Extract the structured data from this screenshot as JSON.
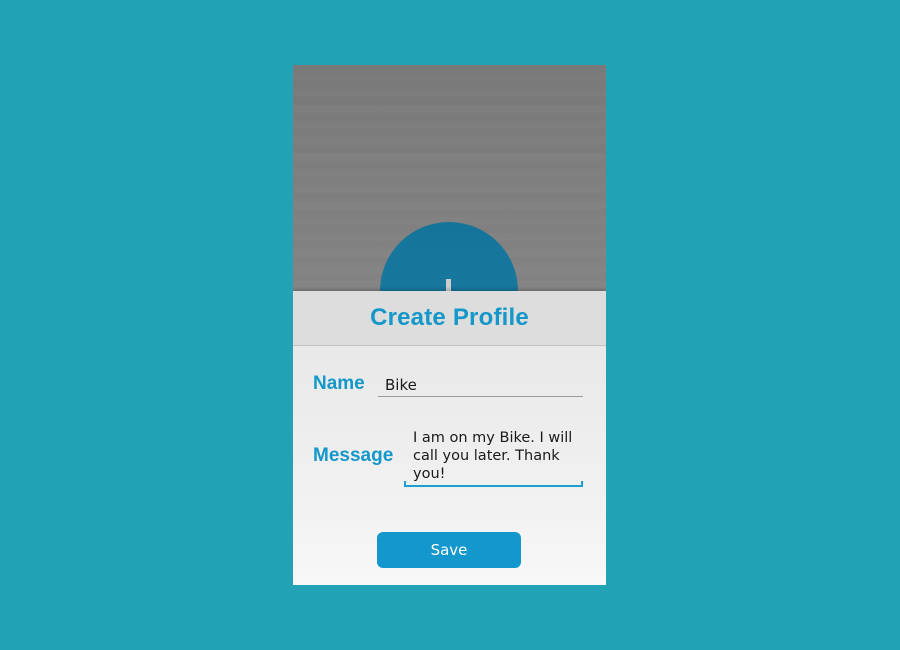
{
  "dialog": {
    "title": "Create Profile"
  },
  "form": {
    "name_label": "Name",
    "name_value": "Bike",
    "message_label": "Message",
    "message_value": "I am on my Bike. I will call you later. Thank you!",
    "save_label": "Save"
  },
  "colors": {
    "page_background": "#22a3b5",
    "accent": "#1497c9",
    "backdrop_circle": "#0a6f97"
  }
}
